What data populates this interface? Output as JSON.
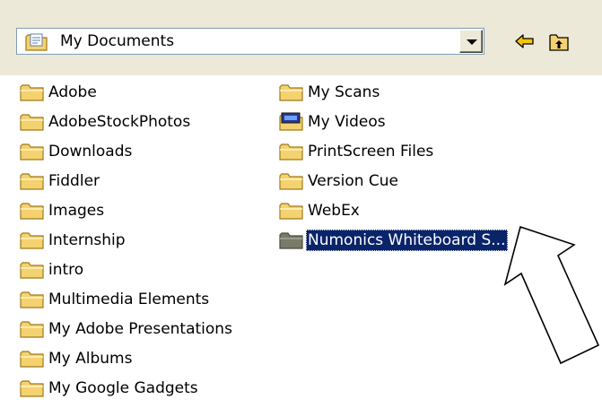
{
  "location": {
    "label": "My Documents",
    "icon": "documents-folder-icon"
  },
  "toolbar": {
    "back_icon": "back-arrow-icon",
    "up_icon": "up-folder-icon"
  },
  "folders": {
    "left": [
      "Adobe",
      "AdobeStockPhotos",
      "Downloads",
      "Fiddler",
      "Images",
      "Internship",
      "intro",
      "Multimedia Elements",
      "My Adobe Presentations",
      "My Albums",
      "My Google Gadgets"
    ],
    "right": [
      "My Scans",
      "My Videos",
      "PrintScreen Files",
      "Version Cue",
      "WebEx",
      "Numonics Whiteboard S..."
    ]
  },
  "selected_item": "Numonics Whiteboard S...",
  "colors": {
    "toolbar_bg": "#ece9d8",
    "folder_yellow": "#f5d270",
    "selection_bg": "#0a246a",
    "back_arrow": "#f5c400"
  }
}
